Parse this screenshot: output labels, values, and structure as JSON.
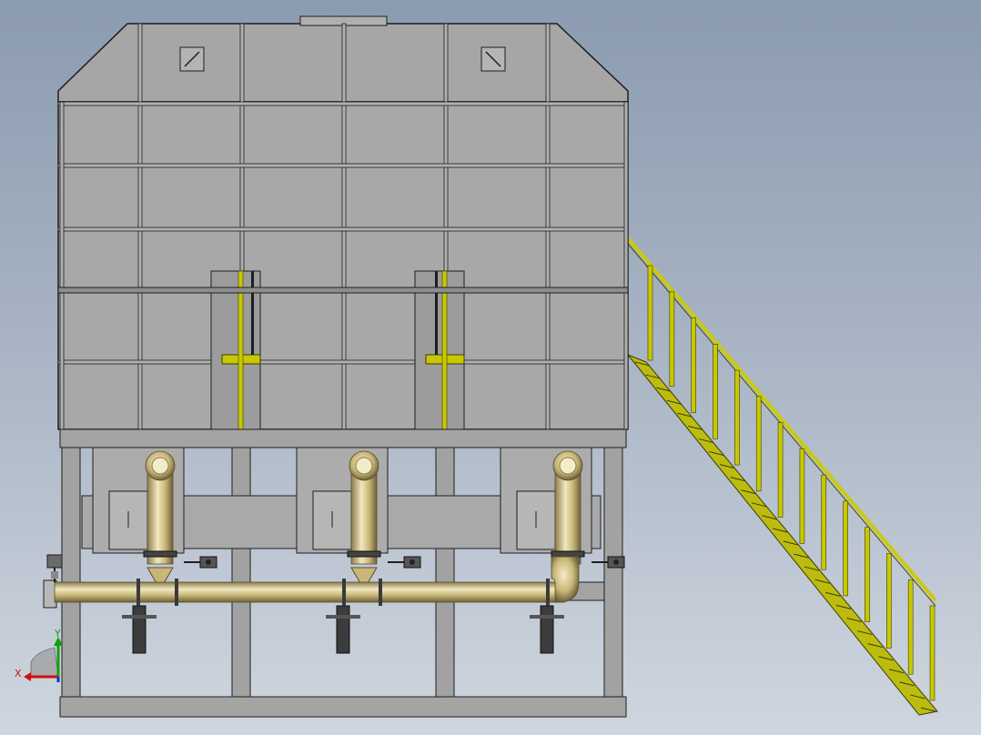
{
  "triad": {
    "x_label": "X",
    "y_label": "Y",
    "x_color": "#d01010",
    "y_color": "#10a010",
    "z_color": "#1030d0"
  },
  "colors": {
    "background_top": "#8b9bb0",
    "background_bottom": "#cfd6df",
    "housing": "#a8a8a8",
    "frame": "#9a9a9a",
    "stair": "#c8c800",
    "pipe_gold": "#c9b779"
  }
}
